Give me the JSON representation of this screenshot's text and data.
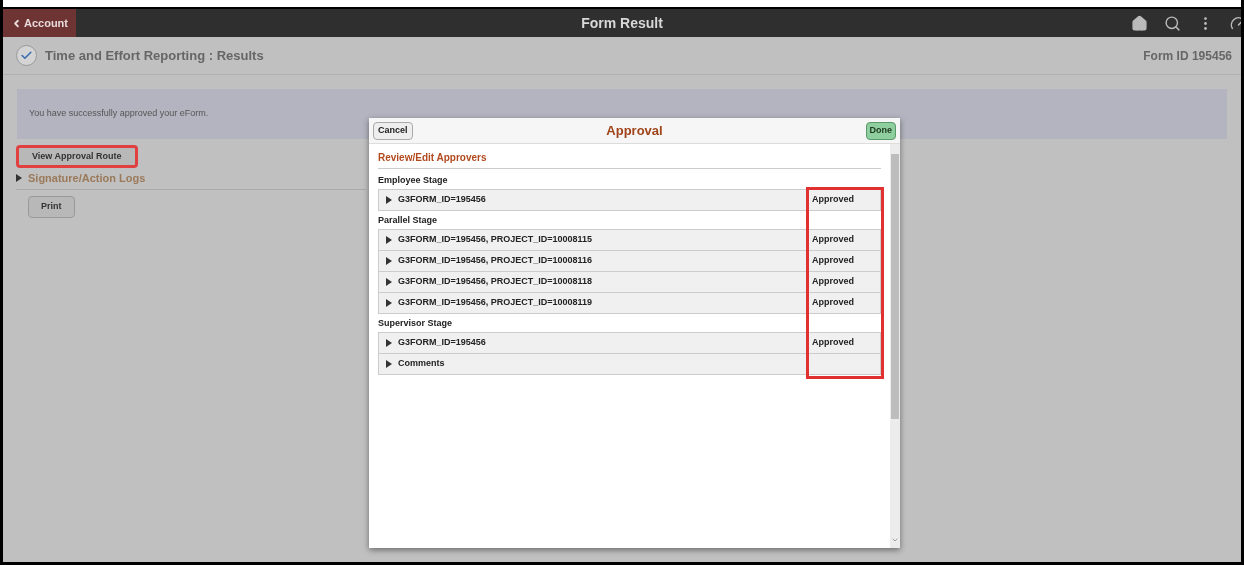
{
  "header": {
    "back_button": "Account",
    "title": "Form Result"
  },
  "page": {
    "title": "Time and Effort Reporting : Results",
    "form_id": "Form ID 195456",
    "message": "You have successfully approved your eForm.",
    "route_button": "View Approval Route",
    "route_button_highlighted": true,
    "logs_link": "Signature/Action Logs",
    "logs_expanded": false,
    "print_button": "Print"
  },
  "dialog": {
    "cancel": "Cancel",
    "title": "Approval",
    "done": "Done",
    "section": "Review/Edit Approvers",
    "status_highlighted": true,
    "stages": [
      {
        "label": "Employee Stage",
        "rows": [
          {
            "label": "G3FORM_ID=195456",
            "status": "Approved",
            "expanded": false
          }
        ]
      },
      {
        "label": "Parallel Stage",
        "rows": [
          {
            "label": "G3FORM_ID=195456, PROJECT_ID=10008115",
            "status": "Approved",
            "expanded": false
          },
          {
            "label": "G3FORM_ID=195456, PROJECT_ID=10008116",
            "status": "Approved",
            "expanded": false
          },
          {
            "label": "G3FORM_ID=195456, PROJECT_ID=10008118",
            "status": "Approved",
            "expanded": false
          },
          {
            "label": "G3FORM_ID=195456, PROJECT_ID=10008119",
            "status": "Approved",
            "expanded": false
          }
        ]
      },
      {
        "label": "Supervisor Stage",
        "rows": [
          {
            "label": "G3FORM_ID=195456",
            "status": "Approved",
            "expanded": false
          }
        ]
      }
    ],
    "comments": {
      "label": "Comments",
      "expanded": false
    }
  }
}
